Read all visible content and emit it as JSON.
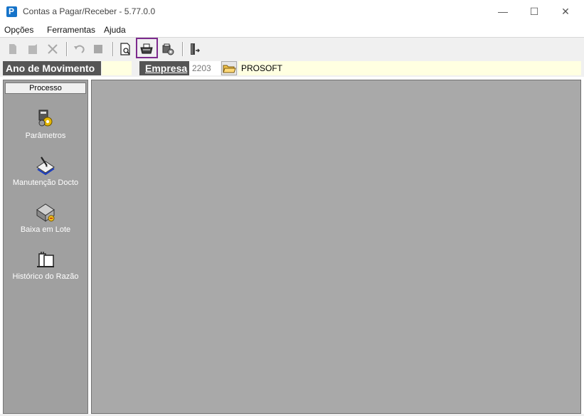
{
  "window": {
    "title": "Contas a Pagar/Receber - 5.77.0.0",
    "app_icon_letter": "P",
    "minimize": "—",
    "maximize": "☐",
    "close": "✕"
  },
  "menu": {
    "items": [
      "Opções",
      "Ferramentas",
      "Ajuda"
    ]
  },
  "toolbar": {
    "buttons": [
      "new-doc",
      "edit-doc",
      "delete",
      "undo",
      "stop",
      "print-preview",
      "print",
      "settings-print",
      "exit"
    ]
  },
  "fields": {
    "ano_label": "Ano de Movimento",
    "ano_value": "",
    "empresa_label": "Empresa",
    "empresa_code": "2203",
    "empresa_name": "PROSOFT"
  },
  "sidebar": {
    "header": "Processo",
    "items": [
      {
        "label": "Parâmetros",
        "icon": "gears-icon"
      },
      {
        "label": "Manutenção Docto",
        "icon": "notebook-pen-icon"
      },
      {
        "label": "Baixa em Lote",
        "icon": "batch-drive-icon"
      },
      {
        "label": "Histórico do Razão",
        "icon": "ledger-book-icon"
      }
    ]
  },
  "colors": {
    "highlight_border": "#7d2a8e",
    "sidebar_bg": "#a0a0a0",
    "main_bg": "#a9a9a9",
    "field_bg": "#ffffe1"
  }
}
